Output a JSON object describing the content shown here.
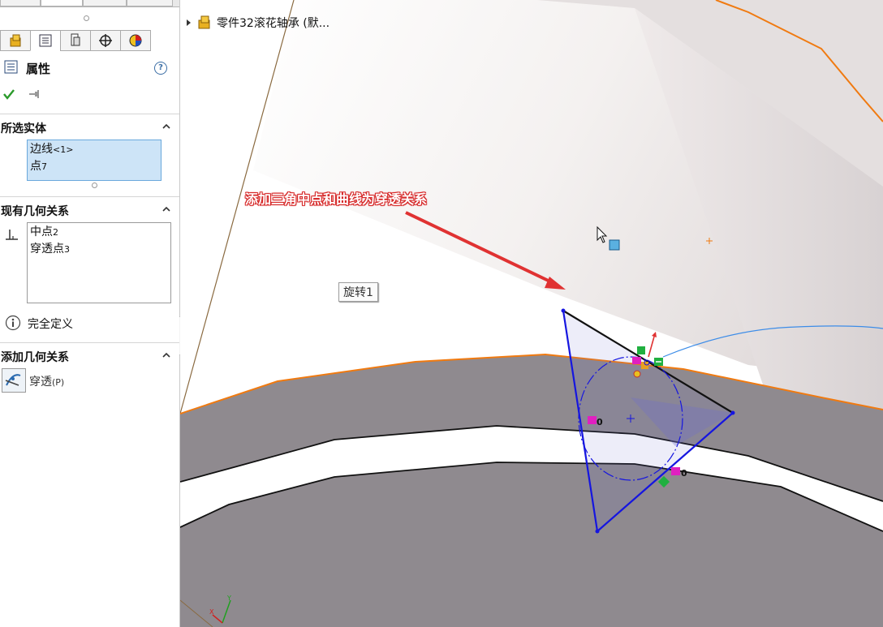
{
  "panel": {
    "title": "属性",
    "help_glyph": "?",
    "tabs": [
      "feature-manager-icon",
      "property-manager-icon",
      "configuration-manager-icon",
      "dimxpert-icon",
      "display-manager-icon"
    ],
    "ok_icon": "checkmark-icon",
    "pin_icon": "pushpin-icon",
    "selected_entities": {
      "header": "所选实体",
      "items": [
        {
          "text": "边线",
          "sub": "<1>"
        },
        {
          "text": "点",
          "sub": "7"
        }
      ]
    },
    "existing_relations": {
      "header": "现有几何关系",
      "items": [
        {
          "text": "中点",
          "sub": "2"
        },
        {
          "text": "穿透点",
          "sub": "3"
        }
      ],
      "status_icon": "info-icon",
      "status": "完全定义"
    },
    "add_relations": {
      "header": "添加几何关系",
      "button_icon": "pierce-relation-icon",
      "label": "穿透",
      "shortcut": "(P)"
    }
  },
  "viewport": {
    "tree_item": "零件32滚花轴承 (默...",
    "feature_tag": "旋转1",
    "annotation": "添加三角中点和曲线为穿透关系",
    "relation_marker_value": "0",
    "colors": {
      "sketch": "#1515e0",
      "edge_orange": "#f07a10",
      "arrow_red": "#e03232",
      "body_grey": "#8d888d",
      "highlight_curve": "#3c8ce8"
    }
  }
}
